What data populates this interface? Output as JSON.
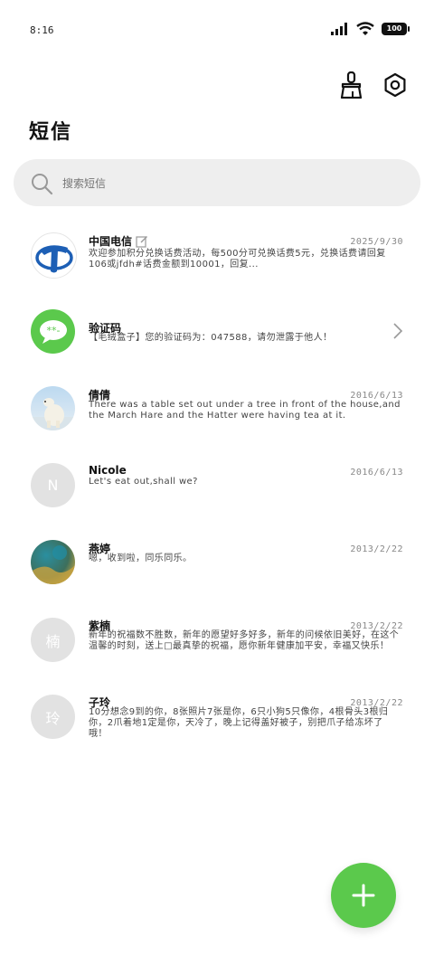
{
  "status": {
    "time": "8:16",
    "battery": "100"
  },
  "toolbar": {
    "clean_icon": "broom-icon",
    "settings_icon": "gear-icon"
  },
  "title": "短信",
  "search": {
    "placeholder": "搜索短信"
  },
  "messages": [
    {
      "name": "中国电信",
      "date": "2025/9/30",
      "preview": "欢迎参加积分兑换话费活动，每500分可兑换话费5元，兑换话费请回复106或jfdh#话费金额到10001，回复...",
      "avatar": "telecom-logo",
      "has_edit_icon": true
    },
    {
      "name": "验证码",
      "date": "",
      "preview": "【毛绒盒子】您的验证码为：047588，请勿泄露于他人！",
      "avatar": "chat-bubble-icon"
    },
    {
      "name": "倩倩",
      "date": "2016/6/13",
      "preview": "There was a table set out under a tree in front of the house,and the March Hare and the Hatter were having tea at it.",
      "avatar": "polar-bear-photo"
    },
    {
      "name": "Nicole",
      "date": "2016/6/13",
      "preview": "Let's eat out,shall we?",
      "avatar_letter": "N"
    },
    {
      "name": "燕婷",
      "date": "2013/2/22",
      "preview": "嗯，收到啦，同乐同乐。",
      "avatar": "landscape-photo"
    },
    {
      "name": "紫楠",
      "date": "2013/2/22",
      "preview": "新年的祝福数不胜数，新年的愿望好多好多，新年的问候依旧美好，在这个温馨的时刻，送上□最真挚的祝福，愿你新年健康加平安，幸福又快乐！",
      "avatar_letter": "楠"
    },
    {
      "name": "子玲",
      "date": "2013/2/22",
      "preview": "10分想念9到的你，8张照片7张是你，6只小狗5只像你，4根骨头3根归你，2爪着地1定是你，天冷了，晚上记得盖好被子，别把爪子给冻坏了哦！",
      "avatar_letter": "玲"
    }
  ],
  "fab": {
    "icon": "plus-icon"
  },
  "colors": {
    "accent": "#5bc94c",
    "telecom_blue": "#1d5fb5"
  }
}
